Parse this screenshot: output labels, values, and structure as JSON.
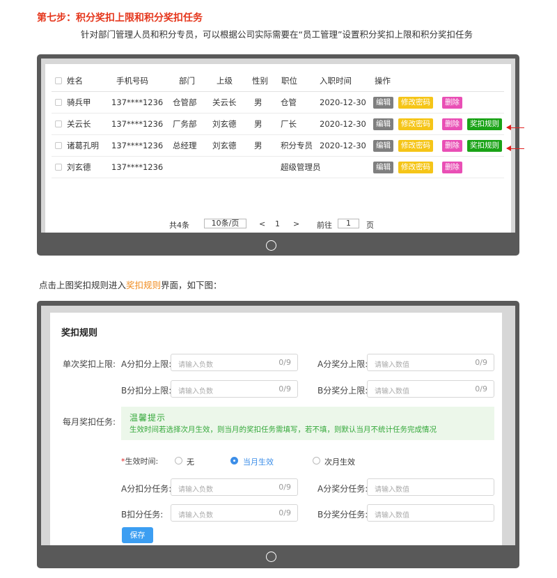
{
  "header": {
    "title": "第七步：积分奖扣上限和积分奖扣任务",
    "description": "针对部门管理人员和积分专员，可以根据公司实际需要在“员工管理”设置积分奖扣上限和积分奖扣任务"
  },
  "staff_table": {
    "columns": [
      "姓名",
      "手机号码",
      "部门",
      "上级",
      "性别",
      "职位",
      "入职时间",
      "操作"
    ],
    "rows": [
      {
        "name": "骑兵甲",
        "phone": "137****1236",
        "dept": "仓管部",
        "superior": "关云长",
        "gender": "男",
        "position": "仓管",
        "join_date": "2020-12-30",
        "has_rule": false
      },
      {
        "name": "关云长",
        "phone": "137****1236",
        "dept": "厂务部",
        "superior": "刘玄德",
        "gender": "男",
        "position": "厂长",
        "join_date": "2020-12-30",
        "has_rule": true
      },
      {
        "name": "诸葛孔明",
        "phone": "137****1236",
        "dept": "总经理",
        "superior": "刘玄德",
        "gender": "男",
        "position": "积分专员",
        "join_date": "2020-12-30",
        "has_rule": true
      },
      {
        "name": "刘玄德",
        "phone": "137****1236",
        "dept": "",
        "superior": "",
        "gender": "",
        "position": "超级管理员",
        "join_date": "",
        "has_rule": false
      }
    ],
    "actions": {
      "edit": "编辑",
      "change_password": "修改密码",
      "delete": "删除",
      "rules": "奖扣规则"
    },
    "pagination": {
      "total": "共4条",
      "page_size": "10条/页",
      "prev": "<",
      "current": "1",
      "next": ">",
      "goto_label": "前往",
      "goto_value": "1",
      "page_unit": "页"
    }
  },
  "intro": {
    "before": "点击上图奖扣规则进入",
    "highlight": "奖扣规则",
    "after": "界面，如下图："
  },
  "rules_form": {
    "title": "奖扣规则",
    "single_limit": {
      "label": "单次奖扣上限:",
      "a_deduct": {
        "label": "A分扣分上限:",
        "placeholder": "请输入负数",
        "count": "0/9"
      },
      "a_award": {
        "label": "A分奖分上限:",
        "placeholder": "请输入数值",
        "count": "0/9"
      },
      "b_deduct": {
        "label": "B分扣分上限:",
        "placeholder": "请输入负数",
        "count": "0/9"
      },
      "b_award": {
        "label": "B分奖分上限:",
        "placeholder": "请输入数值",
        "count": "0/9"
      }
    },
    "monthly_task": {
      "label": "每月奖扣任务:",
      "tip_title": "温馨提示",
      "tip_text": "生效时间若选择次月生效，则当月的奖扣任务需填写，若不填，则默认当月不统计任务完成情况",
      "effective_required_mark": "*",
      "effective_label": "生效时间:",
      "effective_options": [
        "无",
        "当月生效",
        "次月生效"
      ],
      "effective_selected": "当月生效",
      "a_deduct": {
        "label": "A分扣分任务:",
        "placeholder": "请输入负数",
        "count": "0/9"
      },
      "a_award": {
        "label": "A分奖分任务:",
        "placeholder": "请输入数值"
      },
      "b_deduct": {
        "label": "B扣分任务:",
        "placeholder": "请输入负数",
        "count": "0/9"
      },
      "b_award": {
        "label": "B分奖分任务:",
        "placeholder": "请输入数值"
      }
    },
    "save_label": "保存"
  },
  "colors": {
    "title_red": "#e5361c",
    "highlight_orange": "#f08a1c",
    "edit": "#7f7f7f",
    "password": "#f5c518",
    "delete": "#e94fb5",
    "rules": "#1aa317",
    "primary": "#3c9ef2",
    "tip_green": "#34a83a"
  },
  "icons": [
    "checkbox-icon",
    "arrow-left-icon",
    "home-button-icon",
    "radio-icon"
  ]
}
